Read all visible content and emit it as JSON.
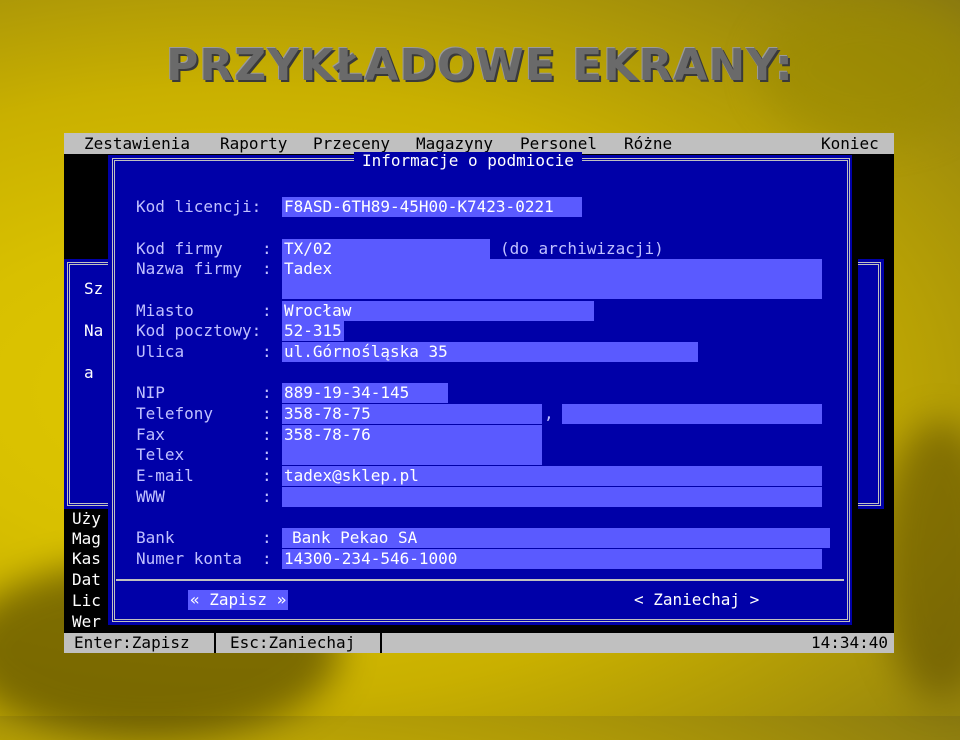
{
  "page_title": "PRZYKŁADOWE EKRANY:",
  "menu": [
    "Zestawienia",
    "Raporty",
    "Przeceny",
    "Magazyny",
    "Personel",
    "Różne",
    "Koniec"
  ],
  "dialog": {
    "title": "Informacje o podmiocie",
    "license": {
      "label": "Kod licencji:",
      "value": "F8ASD-6TH89-45H00-K7423-0221"
    },
    "fields": {
      "kod_firmy": {
        "label": "Kod firmy",
        "value": "TX/02",
        "note": "(do archiwizacji)"
      },
      "nazwa_firmy": {
        "label": "Nazwa firmy",
        "value": "Tadex"
      },
      "miasto": {
        "label": "Miasto",
        "value": "Wrocław"
      },
      "kod_pocztowy": {
        "label": "Kod pocztowy:",
        "value": "52-315"
      },
      "ulica": {
        "label": "Ulica",
        "value": "ul.Górnośląska 35"
      },
      "nip": {
        "label": "NIP",
        "value": "889-19-34-145"
      },
      "telefony": {
        "label": "Telefony",
        "value": "358-78-75",
        "value2": ""
      },
      "fax": {
        "label": "Fax",
        "value": "358-78-76"
      },
      "telex": {
        "label": "Telex",
        "value": ""
      },
      "email": {
        "label": "E-mail",
        "value": "tadex@sklep.pl"
      },
      "www": {
        "label": "WWW",
        "value": ""
      },
      "bank": {
        "label": "Bank",
        "value": "Bank Pekao SA"
      },
      "konto": {
        "label": "Numer konta",
        "value": "14300-234-546-1000"
      }
    },
    "colon": ":",
    "comma": ",",
    "save_button": "« Zapisz »",
    "cancel_button": "< Zaniechaj >"
  },
  "background_window": {
    "left_labels": [
      "Sz",
      "Na",
      "a"
    ],
    "bottom_labels": [
      "Uży",
      "Mag",
      "Kas",
      "Dat",
      "Lic",
      "Wer"
    ]
  },
  "status": {
    "enter": "Enter:Zapisz",
    "esc": "Esc:Zaniechaj",
    "time": "14:34:40"
  }
}
